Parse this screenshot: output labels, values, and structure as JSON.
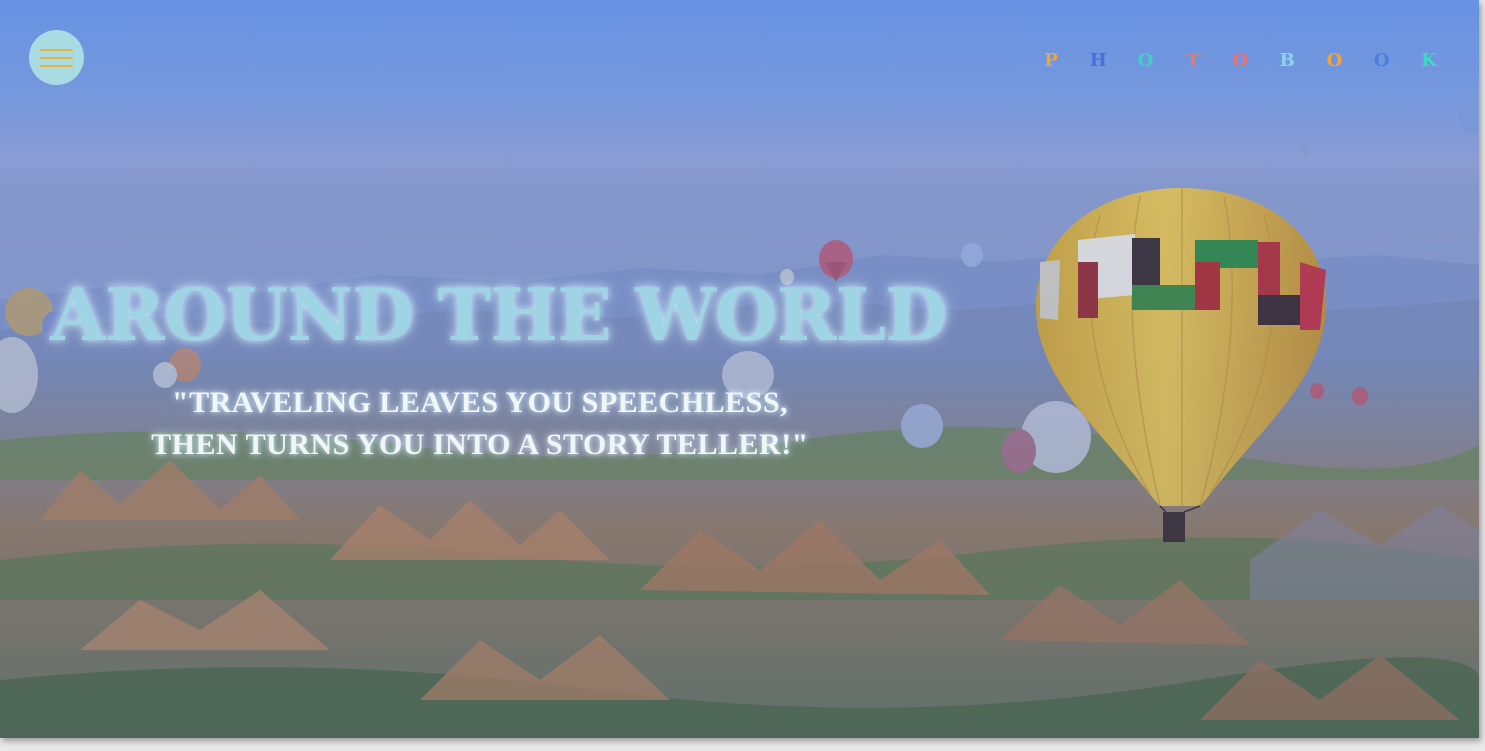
{
  "brand": {
    "letters": [
      {
        "char": "P",
        "color": "#f2a33a"
      },
      {
        "char": "H",
        "color": "#4a6fdc"
      },
      {
        "char": "O",
        "color": "#3fd3c5"
      },
      {
        "char": "T",
        "color": "#f07a5c"
      },
      {
        "char": "O",
        "color": "#f0706c"
      },
      {
        "char": "B",
        "color": "#8fd3ea"
      },
      {
        "char": "O",
        "color": "#f2a33a"
      },
      {
        "char": "O",
        "color": "#4a7fe0"
      },
      {
        "char": "K",
        "color": "#3fd8c0"
      }
    ]
  },
  "menu": {
    "icon": "hamburger-menu-icon",
    "background": "#a9dbe3",
    "bar_color": "#e8b23a"
  },
  "hero": {
    "title": "AROUND THE WORLD",
    "quote": "\"TRAVELING LEAVES YOU SPEECHLESS, THEN TURNS YOU INTO A STORY TELLER!\"",
    "background_image": "hot-air-balloons-over-canyon-landscape"
  },
  "colors": {
    "title": "#9ed4e4",
    "quote": "#eef6f8"
  }
}
